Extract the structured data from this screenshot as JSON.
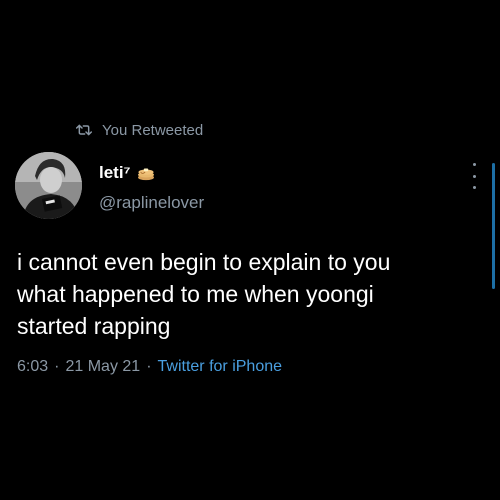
{
  "retweet_banner": {
    "icon": "retweet-icon",
    "label": "You Retweeted"
  },
  "tweet": {
    "author": {
      "display_name": "leti⁷",
      "name_emoji": "pancake-emoji",
      "handle": "@raplinelover",
      "avatar": "avatar-photo"
    },
    "text": "i cannot even begin to explain to you\nwhat happened to me when yoongi\nstarted rapping",
    "time": "6:03",
    "date": "21 May 21",
    "source": "Twitter for iPhone",
    "separator": "·"
  },
  "colors": {
    "background": "#000000",
    "primary_text": "#ffffff",
    "secondary_text": "#8b98a5",
    "link": "#4a9fe0"
  }
}
